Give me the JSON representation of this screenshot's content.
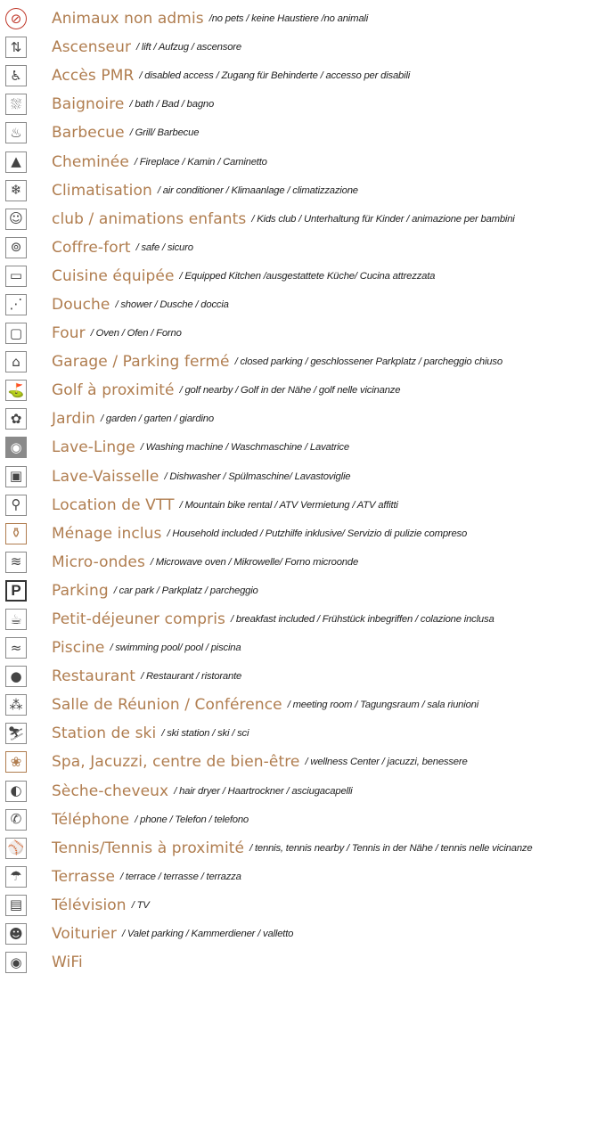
{
  "colors": {
    "label": "#b07d4f",
    "translation": "#222222",
    "icon_border": "#8a8a8a"
  },
  "amenities": [
    {
      "fr": "Animaux non admis",
      "tr": "/no pets / keine Haustiere /no animali",
      "icon": "no-pets-icon",
      "glyph": "⊘",
      "style": "red"
    },
    {
      "fr": "Ascenseur",
      "tr": "/ lift / Aufzug / ascensore",
      "icon": "elevator-icon",
      "glyph": "⇅",
      "style": "outline"
    },
    {
      "fr": "Accès PMR",
      "tr": "/ disabled access / Zugang für Behinderte / accesso per disabili",
      "icon": "wheelchair-icon",
      "glyph": "♿",
      "style": "outline"
    },
    {
      "fr": "Baignoire",
      "tr": "/ bath / Bad / bagno",
      "icon": "bathtub-icon",
      "glyph": "⛆",
      "style": "outline"
    },
    {
      "fr": "Barbecue",
      "tr": "/ Grill/ Barbecue",
      "icon": "barbecue-icon",
      "glyph": "♨",
      "style": "outline"
    },
    {
      "fr": "Cheminée",
      "tr": "/ Fireplace / Kamin / Caminetto",
      "icon": "fireplace-icon",
      "glyph": "▲",
      "style": "outline"
    },
    {
      "fr": "Climatisation",
      "tr": "/ air conditioner / Klimaanlage / climatizzazione",
      "icon": "snowflake-icon",
      "glyph": "❄",
      "style": "outline"
    },
    {
      "fr": "club / animations enfants",
      "tr": "/ Kids club / Unterhaltung für Kinder / animazione per bambini",
      "icon": "kids-club-icon",
      "glyph": "☺",
      "style": "outline"
    },
    {
      "fr": "Coffre-fort",
      "tr": "/ safe / sicuro",
      "icon": "safe-icon",
      "glyph": "⊚",
      "style": "outline"
    },
    {
      "fr": "Cuisine équipée",
      "tr": "/ Equipped Kitchen /ausgestattete Küche/ Cucina attrezzata",
      "icon": "kitchen-icon",
      "glyph": "▭",
      "style": "outline"
    },
    {
      "fr": "Douche",
      "tr": "/ shower / Dusche / doccia",
      "icon": "shower-icon",
      "glyph": "⋰",
      "style": "outline"
    },
    {
      "fr": "Four",
      "tr": "/ Oven / Ofen / Forno",
      "icon": "oven-icon",
      "glyph": "▢",
      "style": "outline"
    },
    {
      "fr": "Garage / Parking fermé",
      "tr": "/ closed parking / geschlossener Parkplatz / parcheggio chiuso",
      "icon": "garage-icon",
      "glyph": "⌂",
      "style": "outline"
    },
    {
      "fr": "Golf à proximité",
      "tr": "/ golf nearby / Golf in der Nähe / golf nelle vicinanze",
      "icon": "golf-icon",
      "glyph": "⛳",
      "style": "outline"
    },
    {
      "fr": "Jardin",
      "tr": "/ garden / garten / giardino",
      "icon": "garden-icon",
      "glyph": "✿",
      "style": "outline"
    },
    {
      "fr": "Lave-Linge",
      "tr": "/ Washing machine / Waschmaschine / Lavatrice",
      "icon": "washing-machine-icon",
      "glyph": "◉",
      "style": "solid"
    },
    {
      "fr": "Lave-Vaisselle",
      "tr": "/ Dishwasher / Spülmaschine/ Lavastoviglie",
      "icon": "dishwasher-icon",
      "glyph": "▣",
      "style": "outline"
    },
    {
      "fr": "Location de VTT",
      "tr": "/ Mountain bike rental / ATV Vermietung / ATV affitti",
      "icon": "bicycle-icon",
      "glyph": "⚲",
      "style": "outline"
    },
    {
      "fr": "Ménage inclus",
      "tr": "/ Household included / Putzhilfe  inklusive/ Servizio di pulizie compreso",
      "icon": "cleaning-icon",
      "glyph": "⚱",
      "style": "gold"
    },
    {
      "fr": "Micro-ondes",
      "tr": "/ Microwave oven / Mikrowelle/ Forno microonde",
      "icon": "microwave-icon",
      "glyph": "≋",
      "style": "outline"
    },
    {
      "fr": "Parking",
      "tr": "/ car park / Parkplatz / parcheggio",
      "icon": "parking-icon",
      "glyph": "P",
      "style": "p"
    },
    {
      "fr": "Petit-déjeuner compris",
      "tr": "/ breakfast included / Frühstück inbegriffen / colazione inclusa",
      "icon": "breakfast-icon",
      "glyph": "☕",
      "style": "outline"
    },
    {
      "fr": "Piscine",
      "tr": "/ swimming pool/ pool / piscina",
      "icon": "pool-icon",
      "glyph": "≈",
      "style": "outline"
    },
    {
      "fr": "Restaurant",
      "tr": "/ Restaurant / ristorante",
      "icon": "restaurant-icon",
      "glyph": "●",
      "style": "outline"
    },
    {
      "fr": "Salle de Réunion / Conférence",
      "tr": "/ meeting room / Tagungsraum / sala riunioni",
      "icon": "meeting-room-icon",
      "glyph": "⁂",
      "style": "outline"
    },
    {
      "fr": "Station de ski",
      "tr": "/ ski station / ski / sci",
      "icon": "ski-icon",
      "glyph": "⛷",
      "style": "outline"
    },
    {
      "fr": "Spa, Jacuzzi, centre de bien-être",
      "tr": "/ wellness Center / jacuzzi, benessere",
      "icon": "spa-icon",
      "glyph": "❀",
      "style": "gold"
    },
    {
      "fr": "Sèche-cheveux",
      "tr": "/ hair dryer / Haartrockner / asciugacapelli",
      "icon": "hair-dryer-icon",
      "glyph": "◐",
      "style": "outline"
    },
    {
      "fr": "Téléphone",
      "tr": "/ phone / Telefon / telefono",
      "icon": "phone-icon",
      "glyph": "✆",
      "style": "outline"
    },
    {
      "fr": "Tennis/Tennis à proximité",
      "tr": "/ tennis, tennis nearby / Tennis in der Nähe / tennis nelle vicinanze",
      "icon": "tennis-icon",
      "glyph": "⚾",
      "style": "outline"
    },
    {
      "fr": "Terrasse",
      "tr": "/ terrace / terrasse / terrazza",
      "icon": "terrace-icon",
      "glyph": "☂",
      "style": "outline"
    },
    {
      "fr": "Télévision",
      "tr": "/ TV",
      "icon": "television-icon",
      "glyph": "▤",
      "style": "outline"
    },
    {
      "fr": "Voiturier",
      "tr": "/ Valet parking / Kammerdiener / valletto",
      "icon": "valet-icon",
      "glyph": "☻",
      "style": "outline"
    },
    {
      "fr": "WiFi",
      "tr": "",
      "icon": "wifi-icon",
      "glyph": "◉",
      "style": "outline"
    }
  ]
}
